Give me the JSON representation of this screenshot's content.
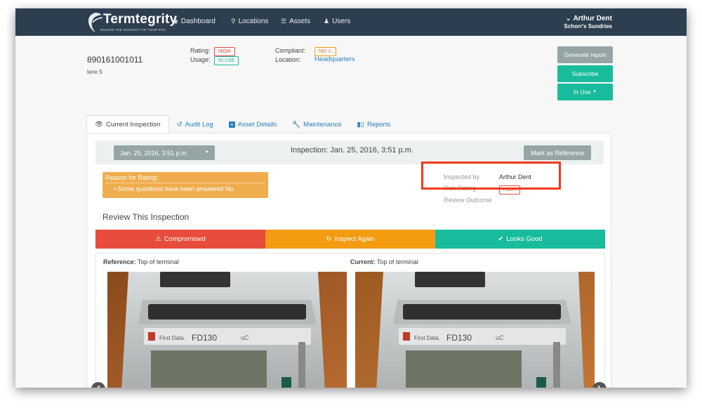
{
  "nav": {
    "brand": "Termtegrity",
    "tagline": "ENSURE THE INTEGRITY OF YOUR POS",
    "items": [
      {
        "label": "Dashboard",
        "icon": "dashboard-icon"
      },
      {
        "label": "Locations",
        "icon": "map-marker-icon"
      },
      {
        "label": "Assets",
        "icon": "list-icon"
      },
      {
        "label": "Users",
        "icon": "user-icon"
      }
    ],
    "user": {
      "name": "Arthur Dent",
      "org": "Schorr's Sundries"
    }
  },
  "asset": {
    "id": "890161001011",
    "subtitle": "lane 5",
    "rating_label": "Rating:",
    "rating": "HIGH",
    "usage_label": "Usage:",
    "usage": "IN USE",
    "compliant_label": "Compliant:",
    "compliant": "NO",
    "location_label": "Location:",
    "location": "Headquarters"
  },
  "buttons": {
    "generate": "Generate report",
    "subscribe": "Subscribe",
    "status": "In Use"
  },
  "tabs": [
    {
      "label": "Current Inspection",
      "icon": "eye-icon",
      "active": true
    },
    {
      "label": "Audit Log",
      "icon": "history-icon"
    },
    {
      "label": "Asset Details",
      "icon": "plus-square-icon"
    },
    {
      "label": "Maintenance",
      "icon": "wrench-icon"
    },
    {
      "label": "Reports",
      "icon": "bar-chart-icon"
    }
  ],
  "inspection": {
    "date_select": "Jan. 25, 2016, 3:51 p.m.",
    "title": "Inspection: Jan. 25, 2016, 3:51 p.m.",
    "mark_reference": "Mark as Reference",
    "reason_head": "Reason for Rating:",
    "reason_item": "Some questions have been answered No.",
    "details": [
      {
        "label": "Inspected by",
        "value": "Arthur Dent"
      },
      {
        "label": "Risk Rating",
        "value": "HIGH"
      },
      {
        "label": "Review Outcome",
        "value": ""
      }
    ],
    "review_title": "Review This Inspection",
    "actions": {
      "compromised": "Compromised",
      "inspect_again": "Inspect Again",
      "looks_good": "Looks Good"
    },
    "reference_label": "Reference:",
    "reference_text": "Top of terminal",
    "current_label": "Current:",
    "current_text": "Top of terminal",
    "terminal_brand": "First Data.",
    "terminal_model": "FD130",
    "terminal_suffix": "uC"
  },
  "colors": {
    "navbar": "#2c3e50",
    "teal": "#18bc9c",
    "red": "#e74c3c",
    "orange": "#f39c12",
    "gray": "#95a5a6",
    "highlight": "#f23b1a"
  }
}
